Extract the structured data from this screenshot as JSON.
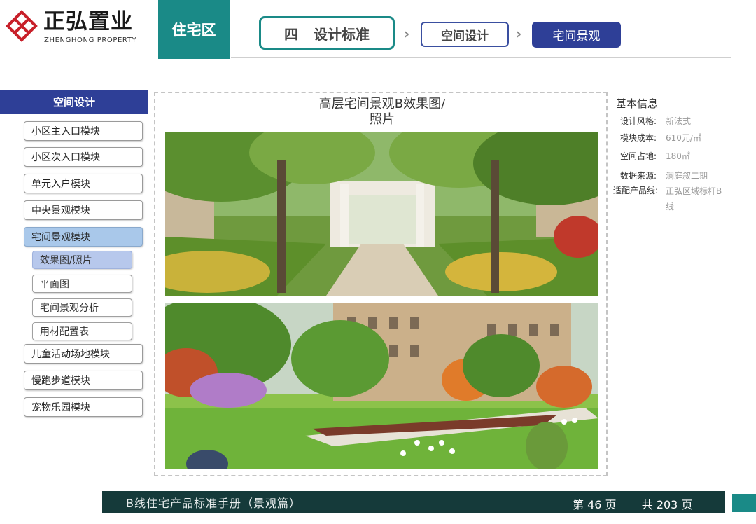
{
  "header": {
    "logo_cn": "正弘置业",
    "logo_en": "ZHENGHONG PROPERTY",
    "zone": "住宅区",
    "crumbs": {
      "main_num": "四",
      "main_label": "设计标准",
      "second": "空间设计",
      "third": "宅间景观"
    }
  },
  "sidebar": {
    "title": "空间设计",
    "items": [
      {
        "label": "小区主入口模块"
      },
      {
        "label": "小区次入口模块"
      },
      {
        "label": "单元入户模块"
      },
      {
        "label": "中央景观模块"
      },
      {
        "label": "宅间景观模块"
      },
      {
        "label": "儿童活动场地模块"
      },
      {
        "label": "慢跑步道模块"
      },
      {
        "label": "宠物乐园模块"
      }
    ],
    "subitems": [
      {
        "label": "效果图/照片"
      },
      {
        "label": "平面图"
      },
      {
        "label": "宅间景观分析"
      },
      {
        "label": "用材配置表"
      }
    ]
  },
  "content": {
    "title_line1": "高层宅间景观B效果图/",
    "title_line2": "照片"
  },
  "info": {
    "heading": "基本信息",
    "rows": [
      {
        "label": "设计风格:",
        "value": "新法式"
      },
      {
        "label": "模块成本:",
        "value": "610元/㎡"
      },
      {
        "label": "空间占地:",
        "value": "180㎡"
      },
      {
        "label": "数据来源:",
        "value": "澜庭叙二期"
      },
      {
        "label": "适配产品线:",
        "value": "正弘区域标杆B",
        "value2": "线"
      }
    ]
  },
  "footer": {
    "title": "B线住宅产品标准手册（景观篇）",
    "page": "第 46 页",
    "total": "共 203 页"
  },
  "colors": {
    "teal": "#1a8a87",
    "navy": "#2e3f97",
    "footer": "#153a3a",
    "active_item": "#a9c8ea"
  }
}
